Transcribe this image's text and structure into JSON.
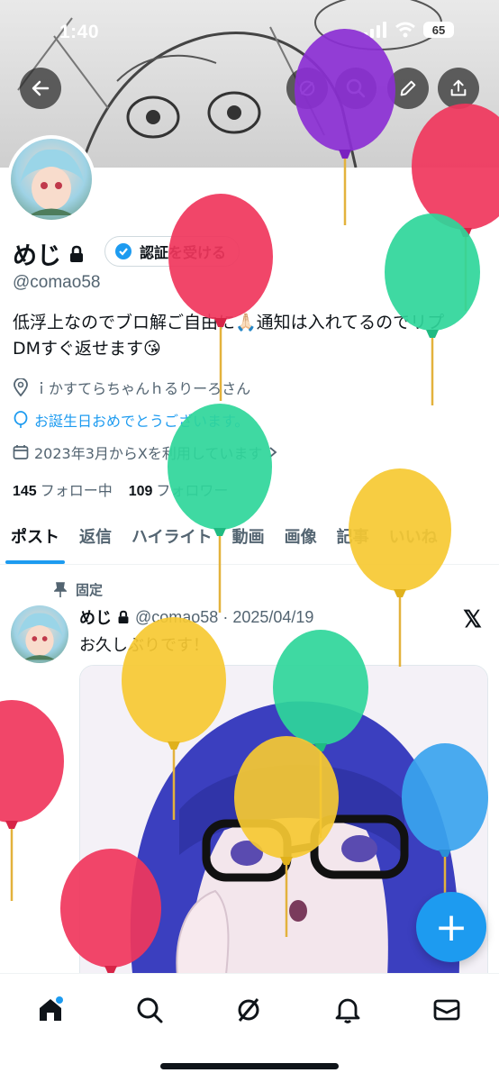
{
  "status_bar": {
    "time": "1:40",
    "battery": "65"
  },
  "profile": {
    "display_name": "めじ",
    "verify_button": "認証を受ける",
    "handle": "@comao58",
    "bio_line1": "低浮上なのでブロ解ご自由に🙏🏻通知は入れてるのでリプ",
    "bio_line2": "DMすぐ返せます😘",
    "location": "ｉかすてらちゃんｈるりーろさん",
    "birthday": "お誕生日おめでとうございます。",
    "joined": "2023年3月からXを利用しています",
    "following_count": "145",
    "following_label": "フォロー中",
    "followers_count": "109",
    "followers_label": "フォロワー"
  },
  "tabs": [
    "ポスト",
    "返信",
    "ハイライト",
    "動画",
    "画像",
    "記事",
    "いいね"
  ],
  "post": {
    "pinned_label": "固定",
    "author": "めじ",
    "handle_date": "@comao58 · 2025/04/19",
    "text": "お久しぶりです！",
    "x_logo": "𝕏"
  },
  "fab_label": "+",
  "colors": {
    "accent": "#1d9bf0",
    "text": "#0f1419",
    "muted": "#536471"
  },
  "icons": [
    "back-arrow-icon",
    "search-icon",
    "edit-icon",
    "share-icon",
    "lock-icon",
    "verified-icon",
    "location-icon",
    "balloon-icon",
    "calendar-icon",
    "pin-icon",
    "home-icon",
    "explore-icon",
    "grok-icon",
    "bell-icon",
    "mail-icon"
  ]
}
